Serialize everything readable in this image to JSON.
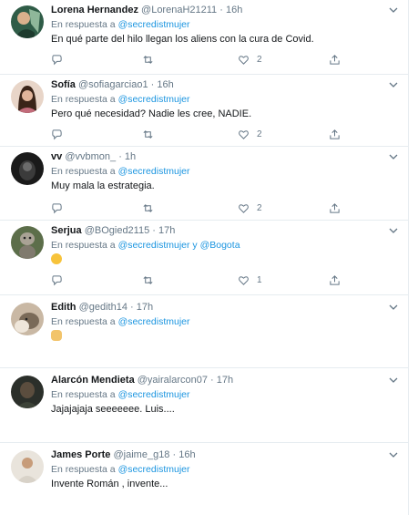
{
  "reply_prefix": "En respuesta a",
  "conjunction": "y",
  "tweets": [
    {
      "name": "Lorena Hernandez",
      "handle": "@LorenaH21211",
      "time": "16h",
      "reply_to": "@secredistmujer",
      "text": "En qué parte del hilo llegan los aliens con la cura de Covid.",
      "likes": "2"
    },
    {
      "name": "Sofía",
      "handle": "@sofiagarciao1",
      "time": "16h",
      "reply_to": "@secredistmujer",
      "text": "Pero qué necesidad? Nadie les cree, NADIE.",
      "likes": "2"
    },
    {
      "name": "vv",
      "handle": "@vvbmon_",
      "time": "1h",
      "reply_to": "@secredistmujer",
      "text": "Muy mala la estrategia.",
      "likes": "2"
    },
    {
      "name": "Serjua",
      "handle": "@BOgied2115",
      "time": "17h",
      "reply_to": "@secredistmujer",
      "reply_to2": "@Bogota",
      "text": "",
      "likes": "1",
      "emoji": "shushing-face-emoji"
    },
    {
      "name": "Edith",
      "handle": "@gedith14",
      "time": "17h",
      "reply_to": "@secredistmujer",
      "text": "",
      "emoji": "woman-facepalming-emoji"
    },
    {
      "name": "Alarcón Mendieta",
      "handle": "@yairalarcon07",
      "time": "17h",
      "reply_to": "@secredistmujer",
      "text": "Jajajajaja seeeeeee. Luis...."
    },
    {
      "name": "James Porte",
      "handle": "@jaime_g18",
      "time": "16h",
      "reply_to": "@secredistmujer",
      "text": "Invente Román , invente..."
    }
  ],
  "colors": {
    "link": "#1b95e0",
    "muted": "#657786",
    "border": "#e6ecf0"
  },
  "icons": [
    "reply-icon",
    "retweet-icon",
    "like-icon",
    "share-icon",
    "caret-down-icon"
  ]
}
